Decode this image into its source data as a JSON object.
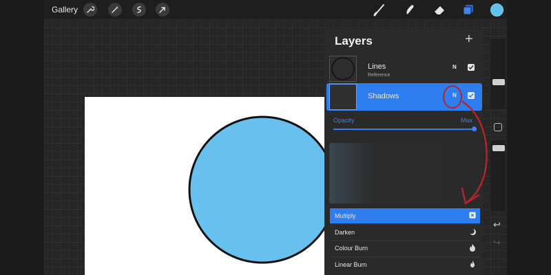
{
  "toolbar": {
    "gallery_label": "Gallery",
    "left_tools": [
      "wrench-icon",
      "magic-wand-icon",
      "selection-icon",
      "transform-arrow-icon"
    ],
    "right_tools": [
      "brush-icon",
      "smudge-icon",
      "eraser-icon",
      "layers-icon"
    ],
    "current_color": "#62c0ec"
  },
  "layers_panel": {
    "title": "Layers",
    "add_symbol": "+",
    "layers": [
      {
        "name": "Lines",
        "subtitle": "Reference",
        "blend_mode": "N",
        "visible": true,
        "selected": false
      },
      {
        "name": "Shadows",
        "subtitle": "",
        "blend_mode": "N",
        "visible": true,
        "selected": true
      }
    ],
    "opacity": {
      "label": "Opacity",
      "value_label": "Max",
      "value": 1.0
    },
    "blend_modes": [
      {
        "label": "Multiply",
        "active": true,
        "icon": "multiply-x-icon"
      },
      {
        "label": "Darken",
        "active": false,
        "icon": "moon-icon"
      },
      {
        "label": "Colour Burn",
        "active": false,
        "icon": "burn-icon"
      },
      {
        "label": "Linear Burn",
        "active": false,
        "icon": "flame-icon"
      }
    ]
  },
  "sidebar": {
    "undo_symbol": "↩",
    "redo_symbol": "↪"
  },
  "colors": {
    "accent": "#2f7ef0",
    "annotation": "#b3242b",
    "circle_fill": "#67c0ee"
  }
}
